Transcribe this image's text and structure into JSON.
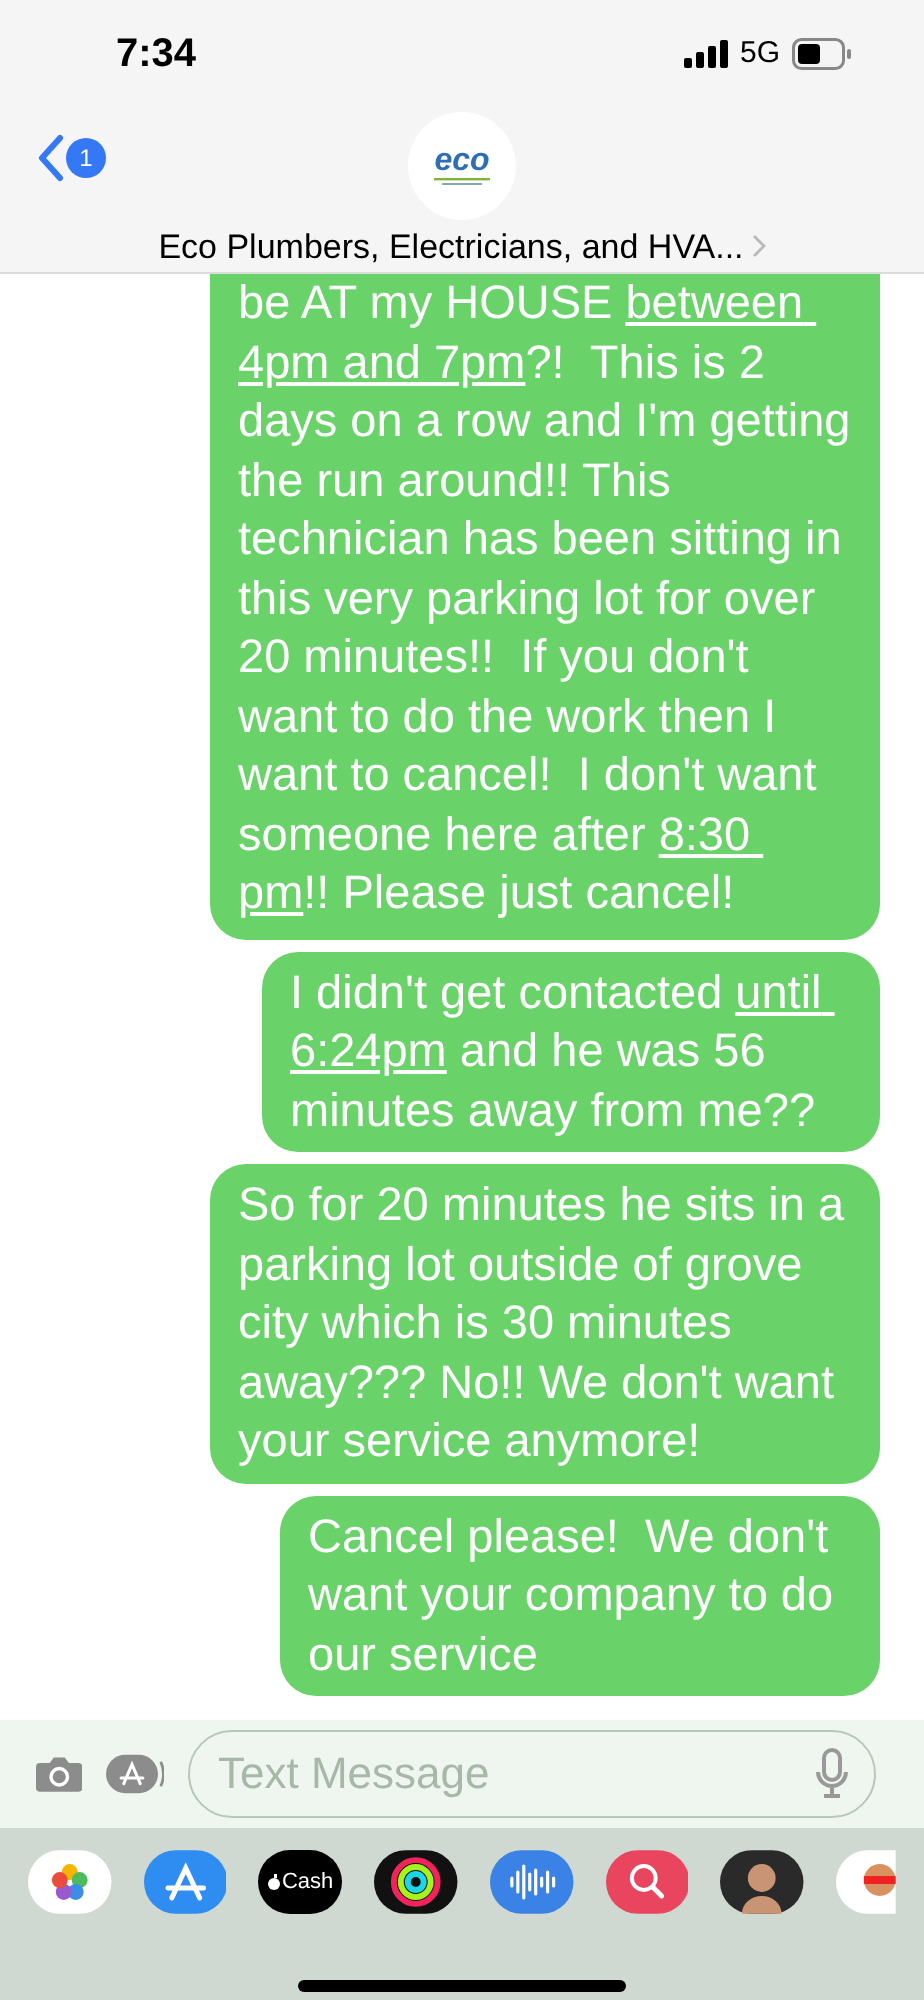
{
  "status_bar": {
    "time": "7:34",
    "network": "5G"
  },
  "header": {
    "back_badge": "1",
    "avatar_text": "eco",
    "contact_name": "Eco Plumbers, Electricians, and HVA..."
  },
  "messages": [
    {
      "segments": [
        {
          "text": "be AT my HOUSE ",
          "link": false
        },
        {
          "text": "between 4pm and 7pm",
          "link": true
        },
        {
          "text": "?!  This is 2 days on a row and I'm getting the run around!! This technician has been sitting in this very parking lot for over 20 minutes!!  If you don't want to do the work then I want to cancel!  I don't want someone here after ",
          "link": false
        },
        {
          "text": "8:30 pm",
          "link": true
        },
        {
          "text": "!! Please just cancel!",
          "link": false
        }
      ]
    },
    {
      "segments": [
        {
          "text": "I didn't get contacted ",
          "link": false
        },
        {
          "text": "until 6:24pm",
          "link": true
        },
        {
          "text": " and he was 56 minutes away from me??",
          "link": false
        }
      ]
    },
    {
      "segments": [
        {
          "text": "So for 20 minutes he sits in a parking lot outside of grove city which is 30 minutes away??? No!! We don't want your service anymore!",
          "link": false
        }
      ]
    },
    {
      "segments": [
        {
          "text": "Cancel please!  We don't want your company to do our service",
          "link": false
        }
      ]
    }
  ],
  "compose": {
    "placeholder": "Text Message"
  },
  "app_tray": {
    "cash_label": "Cash"
  }
}
